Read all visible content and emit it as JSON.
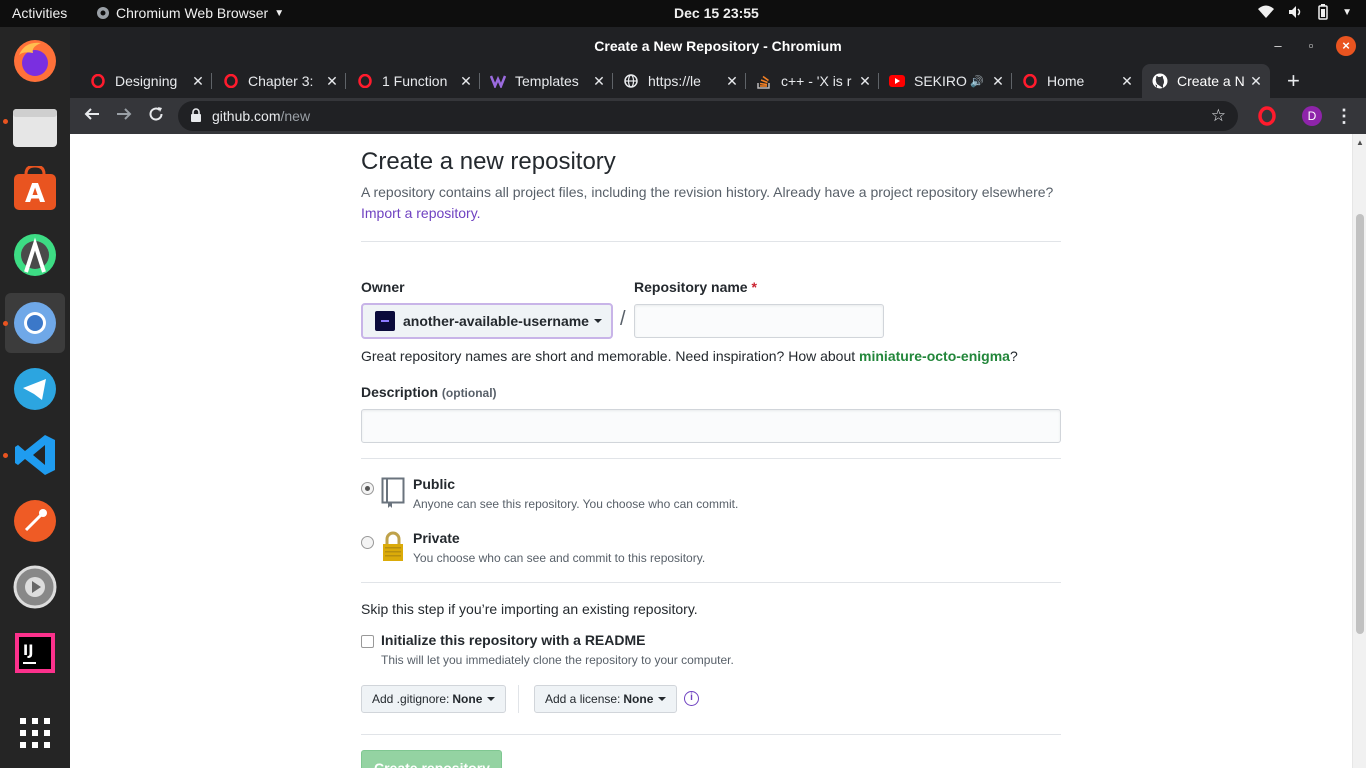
{
  "topbar": {
    "activities": "Activities",
    "app_name": "Chromium Web Browser",
    "clock": "Dec 15  23:55"
  },
  "window": {
    "title": "Create a New Repository - Chromium"
  },
  "tabs": [
    {
      "label": "Designing",
      "favicon": "opera-icon"
    },
    {
      "label": "Chapter 3:",
      "favicon": "opera-icon"
    },
    {
      "label": "1 Function",
      "favicon": "opera-icon"
    },
    {
      "label": "Templates",
      "favicon": "templates-icon"
    },
    {
      "label": "https://le",
      "favicon": "globe-icon"
    },
    {
      "label": "c++ - 'X is r",
      "favicon": "stackoverflow-icon"
    },
    {
      "label": "SEKIRO",
      "favicon": "youtube-icon",
      "audio": true
    },
    {
      "label": "Home",
      "favicon": "opera-icon"
    },
    {
      "label": "Create a N",
      "favicon": "github-icon",
      "active": true
    }
  ],
  "omnibox": {
    "host": "github.com",
    "path": "/new"
  },
  "profile_initial": "D",
  "page": {
    "title": "Create a new repository",
    "subtitle": "A repository contains all project files, including the revision history. Already have a project repository elsewhere?",
    "import_link": "Import a repository.",
    "owner_label": "Owner",
    "owner_value": "another-available-username",
    "slash": "/",
    "repo_name_label": "Repository name",
    "required_mark": "*",
    "repo_name_value": "",
    "suggestion_prefix": "Great repository names are short and memorable. Need inspiration? How about ",
    "suggestion_name": "miniature-octo-enigma",
    "suggestion_suffix": "?",
    "description_label": "Description",
    "description_optional": "(optional)",
    "description_value": "",
    "visibility": [
      {
        "title": "Public",
        "desc": "Anyone can see this repository. You choose who can commit.",
        "selected": true
      },
      {
        "title": "Private",
        "desc": "You choose who can see and commit to this repository.",
        "selected": false
      }
    ],
    "skip_text": "Skip this step if you’re importing an existing repository.",
    "readme_label": "Initialize this repository with a README",
    "readme_desc": "This will let you immediately clone the repository to your computer.",
    "readme_checked": false,
    "gitignore_prefix": "Add .gitignore:",
    "gitignore_value": "None",
    "license_prefix": "Add a license:",
    "license_value": "None",
    "info_glyph": "i",
    "create_button": "Create repository"
  },
  "colors": {
    "link_purple": "#6f42c1",
    "suggestion_green": "#22863a",
    "create_button_bg": "#94d3a2",
    "ubuntu_orange": "#e95420"
  }
}
